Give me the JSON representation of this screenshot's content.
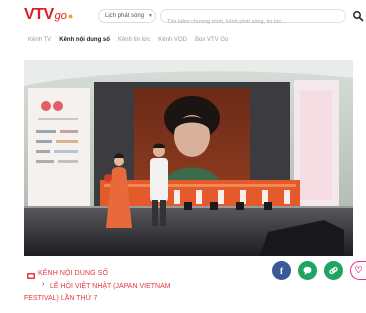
{
  "brand": {
    "name": "VTV",
    "suffix": "go"
  },
  "header": {
    "schedule_label": "Lịch phát sóng",
    "search_placeholder": "Tìm kiếm chương trình, kênh phát sóng, tin tức..."
  },
  "nav": {
    "items": [
      {
        "label": "Kênh TV",
        "active": false
      },
      {
        "label": "Kênh nội dung số",
        "active": true
      },
      {
        "label": "Kênh tin tức",
        "active": false
      },
      {
        "label": "Kênh VOD",
        "active": false
      },
      {
        "label": "Box VTV Go",
        "active": false
      }
    ]
  },
  "video": {
    "media": "stage-performance-frame"
  },
  "footer": {
    "channel_label": "KÊNH NỘI DUNG SỐ",
    "title_line1": "LỄ HỘI VIỆT NHẬT (JAPAN VIETNAM",
    "title_line2": "FESTIVAL) LẦN THỨ 7"
  },
  "share": {
    "buttons": [
      {
        "name": "facebook",
        "icon": "facebook-icon",
        "color": "#3b5998"
      },
      {
        "name": "chat",
        "icon": "chat-icon",
        "color": "#1fa463"
      },
      {
        "name": "link",
        "icon": "link-icon",
        "color": "#1fa463"
      },
      {
        "name": "favorite",
        "icon": "heart-icon",
        "color": "#e8338c"
      }
    ]
  },
  "colors": {
    "accent": "#e21b23",
    "channel": "#e2383f"
  }
}
